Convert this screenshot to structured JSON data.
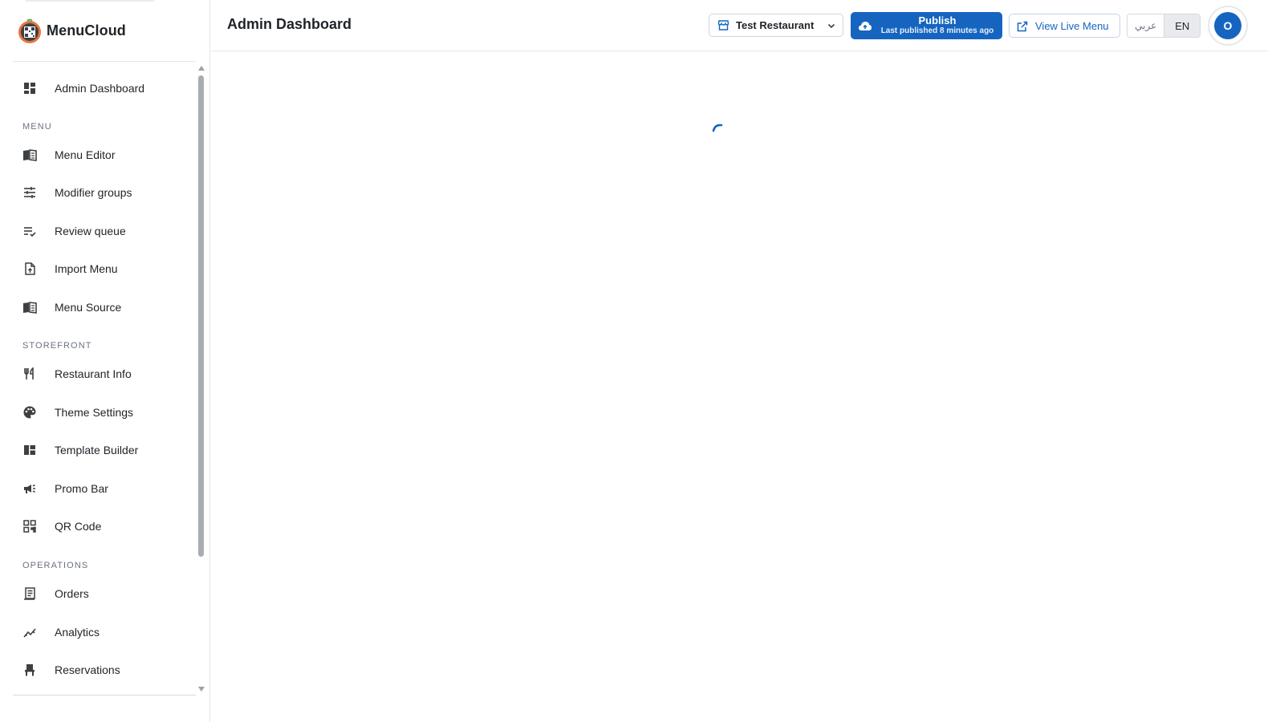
{
  "brand": {
    "name": "MenuCloud"
  },
  "header": {
    "title": "Admin Dashboard",
    "restaurant_select": {
      "value": "Test Restaurant",
      "icon": "store-icon"
    },
    "publish": {
      "label": "Publish",
      "subtitle": "Last published 8 minutes ago",
      "icon": "cloud-upload-icon"
    },
    "view_live": {
      "label": "View Live Menu",
      "icon": "external-link-icon"
    },
    "languages": [
      {
        "label": "عربي",
        "active": false
      },
      {
        "label": "EN",
        "active": true
      }
    ],
    "avatar": {
      "initial": "O"
    }
  },
  "sidebar": {
    "dashboard": {
      "label": "Admin Dashboard",
      "icon": "dashboard-icon"
    },
    "sections": [
      {
        "label": "MENU",
        "items": [
          {
            "label": "Menu Editor",
            "icon": "menu-book-icon"
          },
          {
            "label": "Modifier groups",
            "icon": "tune-icon"
          },
          {
            "label": "Review queue",
            "icon": "playlist-check-icon"
          },
          {
            "label": "Import Menu",
            "icon": "file-upload-icon"
          },
          {
            "label": "Menu Source",
            "icon": "menu-book-icon"
          }
        ]
      },
      {
        "label": "STOREFRONT",
        "items": [
          {
            "label": "Restaurant Info",
            "icon": "restaurant-icon"
          },
          {
            "label": "Theme Settings",
            "icon": "palette-icon"
          },
          {
            "label": "Template Builder",
            "icon": "template-icon"
          },
          {
            "label": "Promo Bar",
            "icon": "megaphone-icon"
          },
          {
            "label": "QR Code",
            "icon": "qr-code-icon"
          }
        ]
      },
      {
        "label": "OPERATIONS",
        "items": [
          {
            "label": "Orders",
            "icon": "receipt-icon"
          },
          {
            "label": "Analytics",
            "icon": "analytics-icon"
          },
          {
            "label": "Reservations",
            "icon": "table-restaurant-icon"
          }
        ]
      }
    ]
  },
  "main": {
    "state": "loading"
  },
  "colors": {
    "accent": "#1565c0",
    "text": "#1f2328",
    "muted": "#6b7280",
    "border": "#e6e8eb"
  }
}
